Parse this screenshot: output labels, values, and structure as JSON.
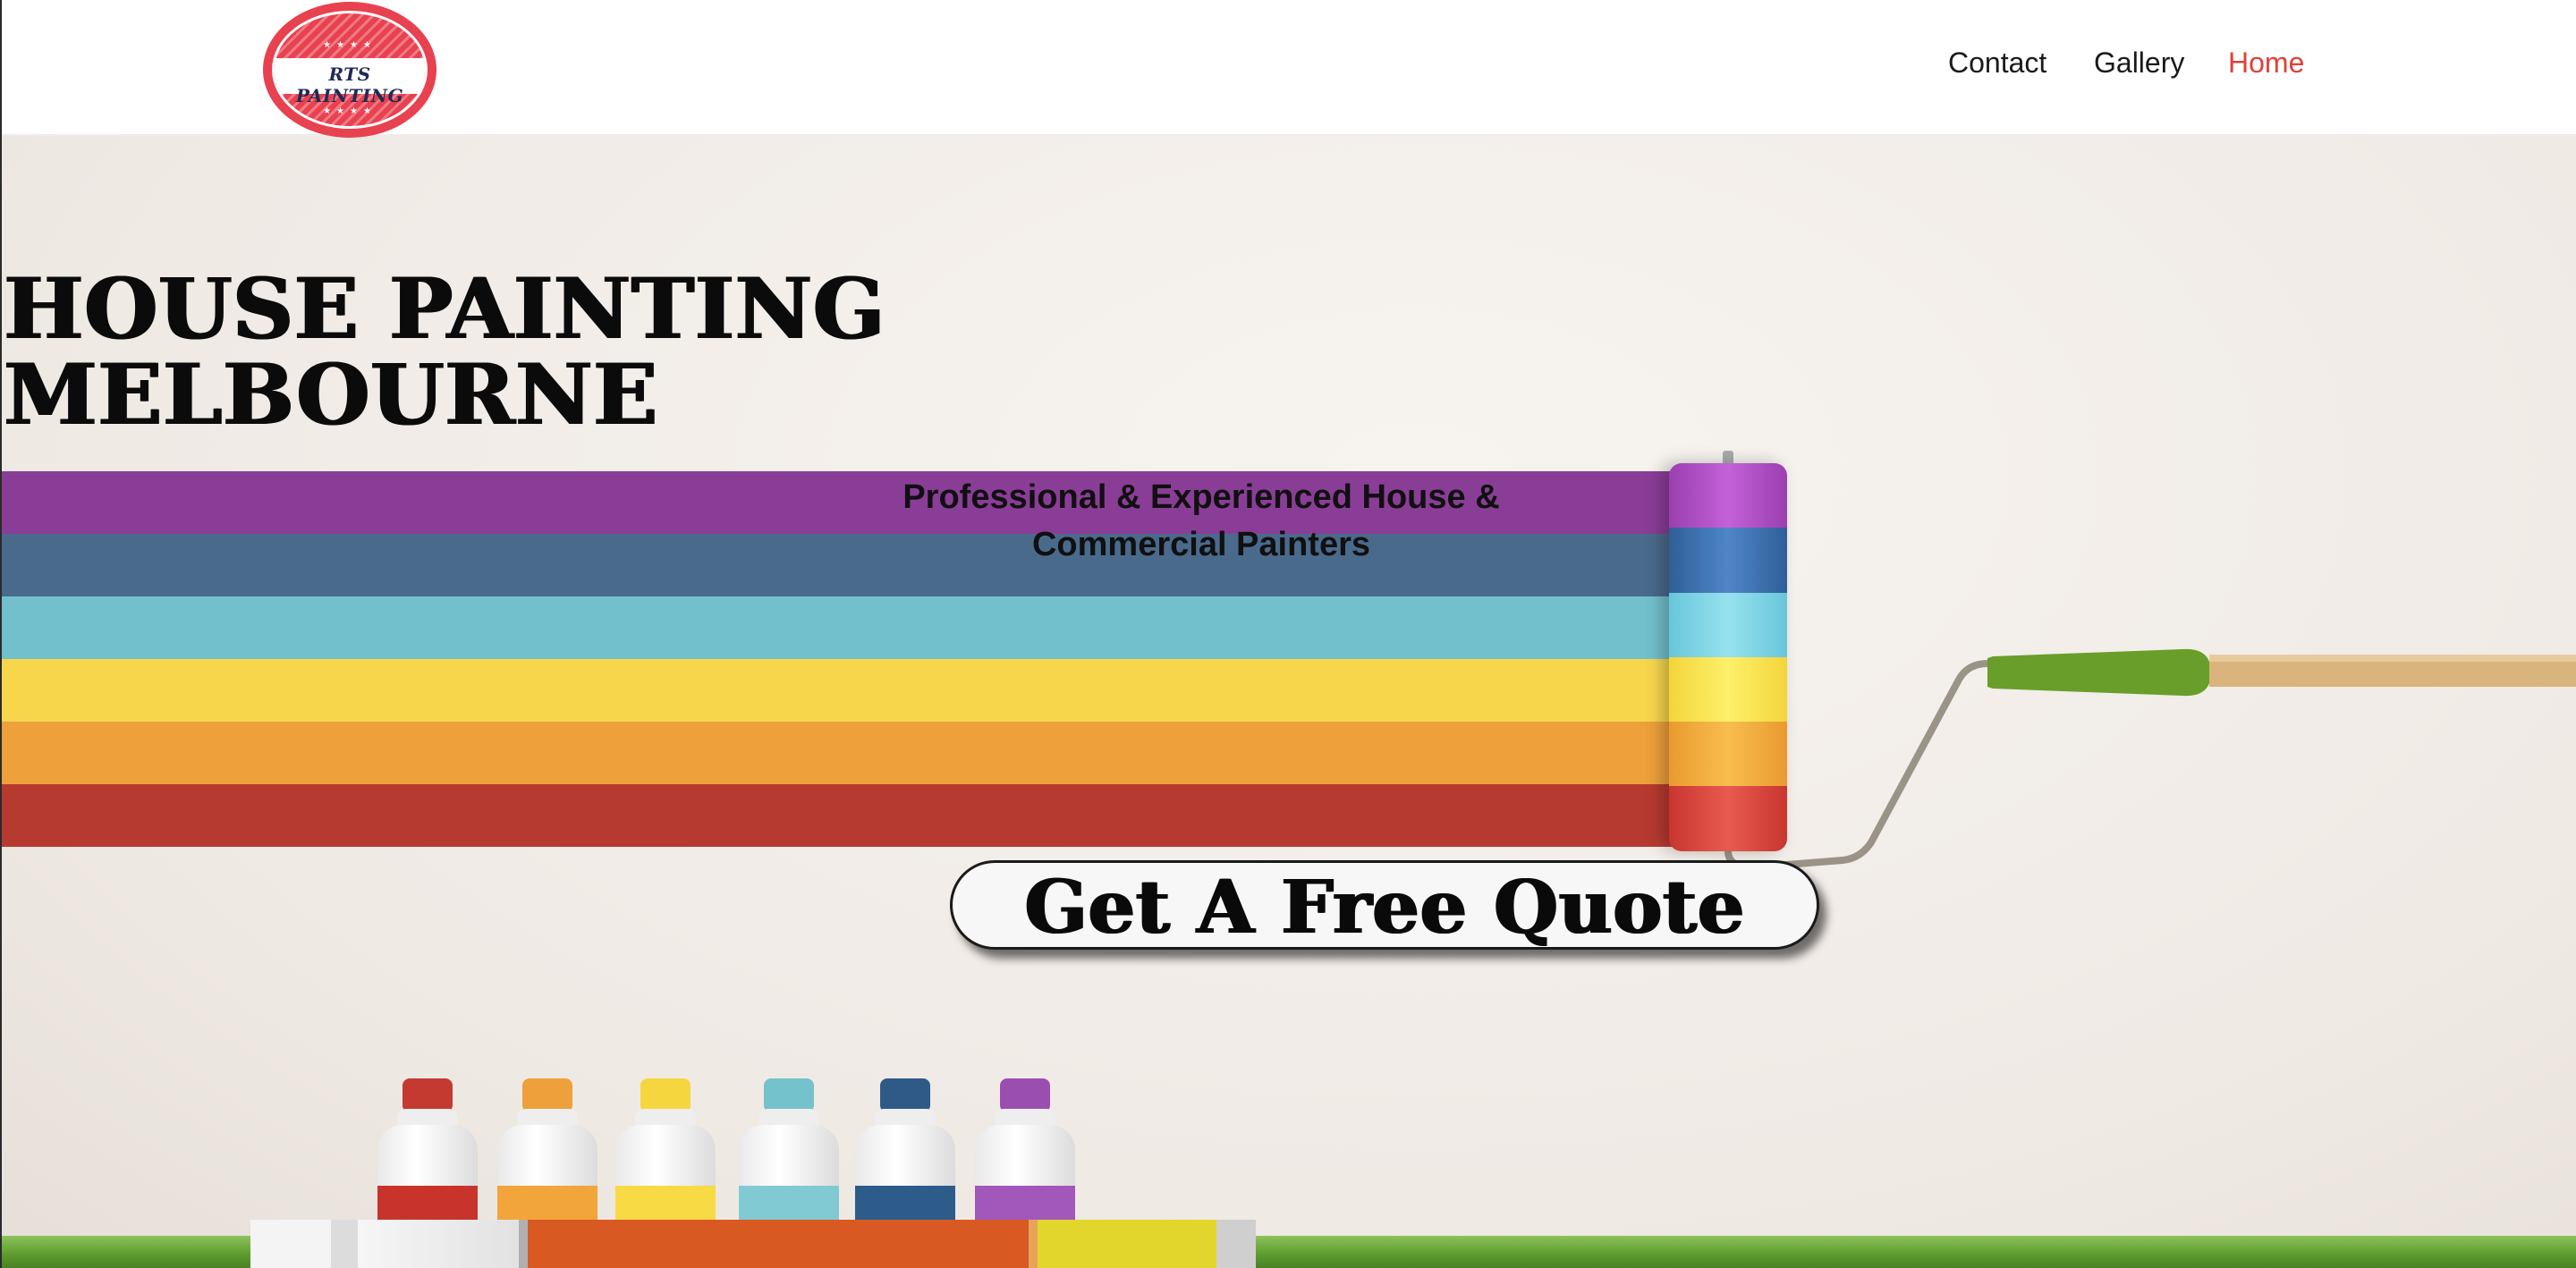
{
  "header": {
    "logo_text": "RTS PAINTING",
    "nav": {
      "contact": "Contact",
      "gallery": "Gallery",
      "home": "Home"
    }
  },
  "hero": {
    "title_line1": "HOUSE PAINTING",
    "title_line2": "MELBOURNE",
    "subtitle_line1": "Professional & Experienced House &",
    "subtitle_line2": "Commercial Painters",
    "cta_label": "Get A Free Quote"
  },
  "colors": {
    "active_nav": "#e0403a",
    "logo_red": "#e8414f",
    "logo_navy": "#1f2a56",
    "stripes": [
      "#8a3d97",
      "#4a6a8c",
      "#72c0cc",
      "#f8d64b",
      "#eea03b",
      "#b73a30"
    ]
  }
}
